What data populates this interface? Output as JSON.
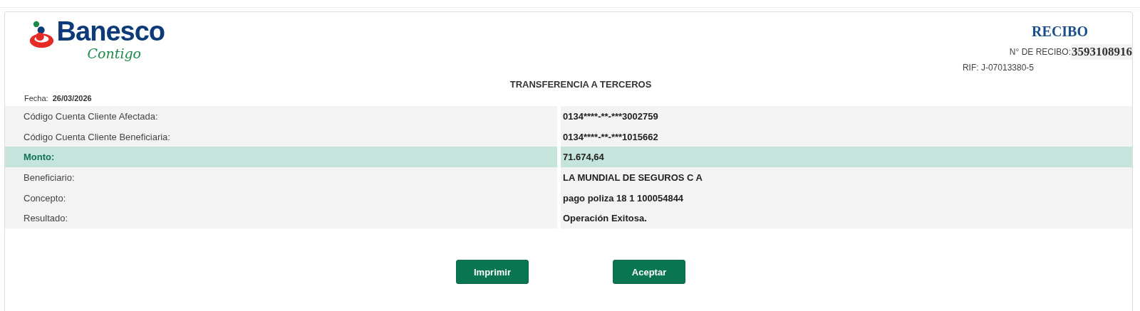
{
  "logo": {
    "name": "Banesco",
    "tagline": "Contigo"
  },
  "receipt": {
    "title": "RECIBO",
    "number_label": "N° DE RECIBO:",
    "number": "3593108916",
    "rif": "RIF: J-07013380-5"
  },
  "heading": "TRANSFERENCIA A TERCEROS",
  "date": {
    "label": "Fecha:",
    "value": "26/03/2026"
  },
  "rows": [
    {
      "label": "Código Cuenta Cliente Afectada:",
      "value": "0134****-**-***3002759",
      "highlighted": false
    },
    {
      "label": "Código Cuenta Cliente Beneficiaria:",
      "value": "0134****-**-***1015662",
      "highlighted": false
    },
    {
      "label": "Monto:",
      "value": "71.674,64",
      "highlighted": true
    },
    {
      "label": "Beneficiario:",
      "value": "LA MUNDIAL DE SEGUROS C A",
      "highlighted": false
    },
    {
      "label": "Concepto:",
      "value": "pago poliza 18 1 100054844",
      "highlighted": false
    },
    {
      "label": "Resultado:",
      "value": "Operación Exitosa.",
      "highlighted": false
    }
  ],
  "buttons": [
    "Imprimir",
    "Aceptar"
  ]
}
